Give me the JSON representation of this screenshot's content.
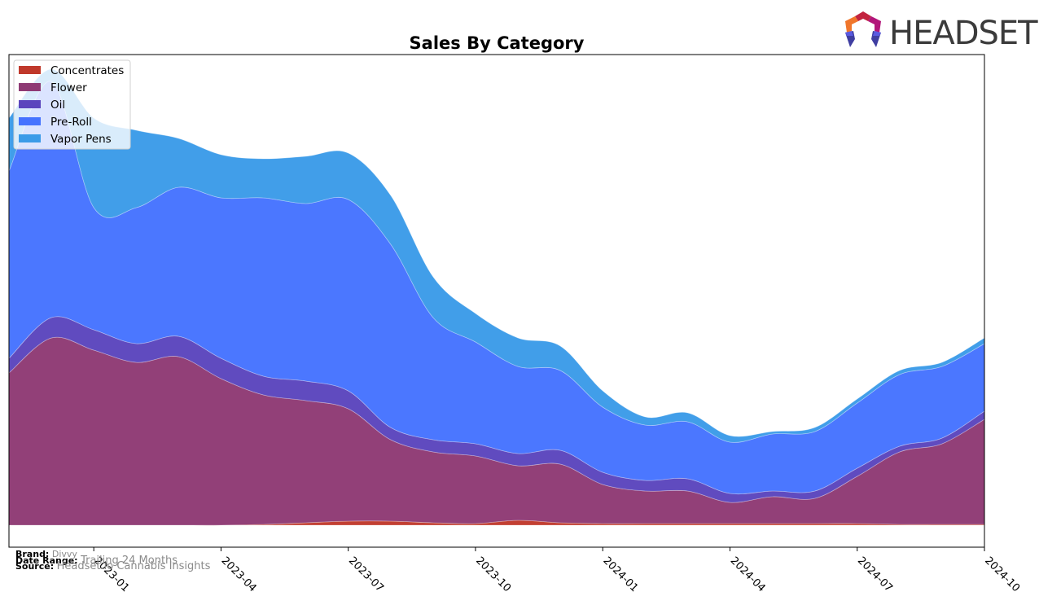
{
  "brand": {
    "logo_text": "HEADSET"
  },
  "footer": {
    "brand_label": "Brand:",
    "brand_value": "Divvy",
    "date_range_label": "Date Range:",
    "date_range_value": "Trailing 24 Months",
    "source_label": "Source:",
    "source_value": "Headset.io Cannabis Insights"
  },
  "chart_data": {
    "type": "area",
    "stacked": true,
    "title": "Sales By Category",
    "xlabel": "",
    "ylabel": "",
    "y_ticks_visible": false,
    "grid": false,
    "legend_position": "top-left",
    "x": [
      "2022-11",
      "2022-12",
      "2023-01",
      "2023-02",
      "2023-03",
      "2023-04",
      "2023-05",
      "2023-06",
      "2023-07",
      "2023-08",
      "2023-09",
      "2023-10",
      "2023-11",
      "2023-12",
      "2024-01",
      "2024-02",
      "2024-03",
      "2024-04",
      "2024-05",
      "2024-06",
      "2024-07",
      "2024-08",
      "2024-09",
      "2024-10"
    ],
    "x_tick_labels": [
      "2023-01",
      "2023-04",
      "2023-07",
      "2023-10",
      "2024-01",
      "2024-04",
      "2024-07",
      "2024-10"
    ],
    "ylim": [
      -27,
      578
    ],
    "series": [
      {
        "name": "Concentrates",
        "color": "#c0392b",
        "values": [
          0,
          0,
          0,
          0,
          0,
          0,
          1,
          3,
          5,
          5,
          3,
          2,
          6,
          3,
          2,
          2,
          2,
          2,
          2,
          2,
          2,
          1,
          1,
          1
        ]
      },
      {
        "name": "Flower",
        "color": "#8e3a74",
        "values": [
          187,
          230,
          215,
          200,
          207,
          180,
          159,
          150,
          138,
          100,
          87,
          83,
          67,
          72,
          48,
          40,
          40,
          26,
          33,
          31,
          58,
          89,
          99,
          129
        ]
      },
      {
        "name": "Oil",
        "color": "#5b45bd",
        "values": [
          18,
          25,
          25,
          23,
          25,
          25,
          23,
          24,
          22,
          15,
          15,
          15,
          15,
          17,
          15,
          13,
          15,
          11,
          7,
          9,
          10,
          7,
          7,
          10
        ]
      },
      {
        "name": "Pre-Roll",
        "color": "#4573ff",
        "values": [
          230,
          290,
          150,
          167,
          183,
          197,
          219,
          218,
          235,
          225,
          150,
          125,
          107,
          98,
          80,
          68,
          70,
          63,
          70,
          73,
          80,
          88,
          88,
          83
        ]
      },
      {
        "name": "Vapor Pens",
        "color": "#3b9be8",
        "values": [
          65,
          15,
          110,
          95,
          60,
          53,
          48,
          58,
          57,
          60,
          50,
          35,
          35,
          30,
          20,
          10,
          11,
          8,
          3,
          5,
          5,
          5,
          5,
          7
        ]
      }
    ]
  }
}
